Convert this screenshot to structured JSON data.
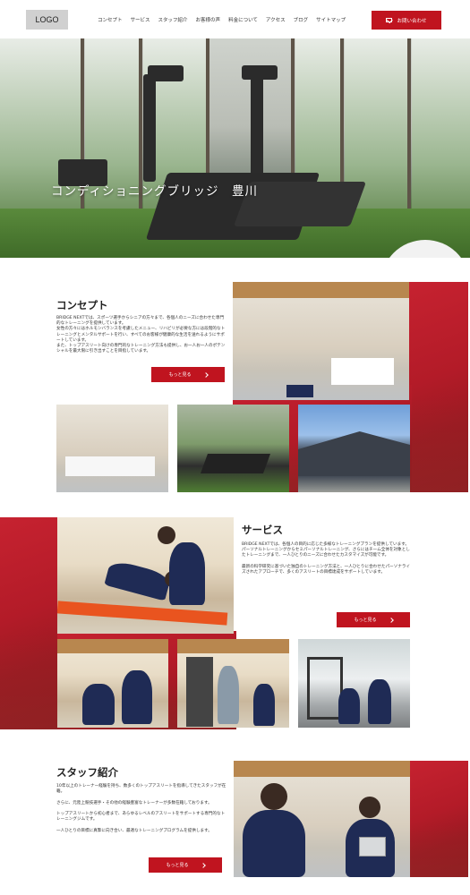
{
  "header": {
    "logo": "LOGO",
    "nav": [
      "コンセプト",
      "サービス",
      "スタッフ紹介",
      "お客様の声",
      "料金について",
      "アクセス",
      "ブログ",
      "サイトマップ"
    ],
    "contact_label": "お問い合わせ"
  },
  "hero": {
    "title": "コンディショニングブリッジ　豊川"
  },
  "concept": {
    "title": "コンセプト",
    "text": "BRIDGE NEXTでは、スポーツ選手からシニアの方々まで、各個人のニーズに合わせた専門的なトレーニングを提供しています。\n女性の方々にはホルモンバランスを考慮したメニュー、リハビリが必要な方には段階的なトレーニングとメンタルサポートを行い、すべてのお客様が健康的な生活を送れるようにサポートしています。\nまた、トップアスリート向けの専門的なトレーニング方法も提供し、お一人お一人のポテンシャルを最大限に引き出すことを目指しています。",
    "button": "もっと見る"
  },
  "service": {
    "title": "サービス",
    "text": "BRIDGE NEXTでは、各個人の目的に応じた多様なトレーニングプランを提供しています。\nパーソナルトレーニングからセミパーソナルトレーニング、さらにはチーム全体を対象としたトレーニングまで、一人ひとりのニーズに合わせたカスタマイズが可能です。\n\n最新の科学研究に基づいた独自のトレーニング方法と、一人ひとりに合わせたパーソナライズされたアプローチで、多くのアスリートの目標達成をサポートしています。",
    "button": "もっと見る"
  },
  "staff": {
    "title": "スタッフ紹介",
    "text": "10年以上のトレーナー経験を持ち、数多くのトップアスリートを指導してきたスタッフが在籍。\n\nさらに、元陸上競技選手・その他の経験豊富なトレーナーが多数在籍しております。\n\nトップアスリートから初心者まで、あらゆるレベルのアスリートをサポートする専門的なトレーニングジムです。\n\n一人ひとりの目標に真摯に向き合い、最適なトレーニングプログラムを提供します。",
    "button": "もっと見る"
  },
  "colors": {
    "accent": "#c0141f",
    "header_bg": "#ffffff",
    "logo_bg": "#d0d0d0"
  }
}
